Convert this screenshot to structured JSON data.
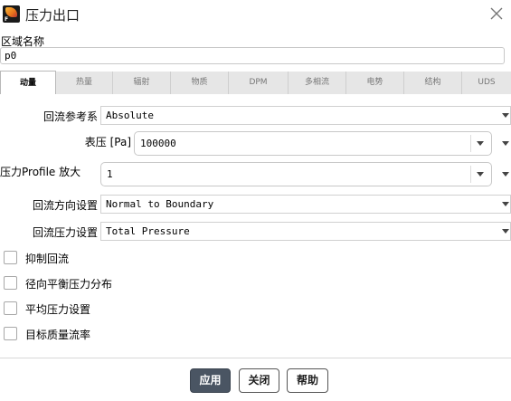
{
  "window": {
    "title": "压力出口",
    "app_icon_letter": "F"
  },
  "zone": {
    "label": "区域名称",
    "value": "p0"
  },
  "tabs": [
    {
      "label": "动量",
      "active": true
    },
    {
      "label": "热量",
      "active": false
    },
    {
      "label": "辐射",
      "active": false
    },
    {
      "label": "物质",
      "active": false
    },
    {
      "label": "DPM",
      "active": false
    },
    {
      "label": "多相流",
      "active": false
    },
    {
      "label": "电势",
      "active": false
    },
    {
      "label": "结构",
      "active": false
    },
    {
      "label": "UDS",
      "active": false
    }
  ],
  "form": {
    "backflow_ref": {
      "label": "回流参考系",
      "value": "Absolute"
    },
    "gauge_pressure": {
      "label": "表压 [Pa]",
      "value": "100000"
    },
    "pressure_profile": {
      "label": "压力Profile 放大",
      "value": "1"
    },
    "backflow_direction": {
      "label": "回流方向设置",
      "value": "Normal to Boundary"
    },
    "backflow_pressure": {
      "label": "回流压力设置",
      "value": "Total Pressure"
    }
  },
  "checkboxes": [
    {
      "label": "抑制回流",
      "checked": false
    },
    {
      "label": "径向平衡压力分布",
      "checked": false
    },
    {
      "label": "平均压力设置",
      "checked": false
    },
    {
      "label": "目标质量流率",
      "checked": false
    }
  ],
  "buttons": {
    "apply": "应用",
    "close": "关闭",
    "help": "帮助"
  },
  "colors": {
    "primary_button": "#4a5563",
    "active_tab": "#ffffff",
    "inactive_tab": "#e6e6e6"
  }
}
